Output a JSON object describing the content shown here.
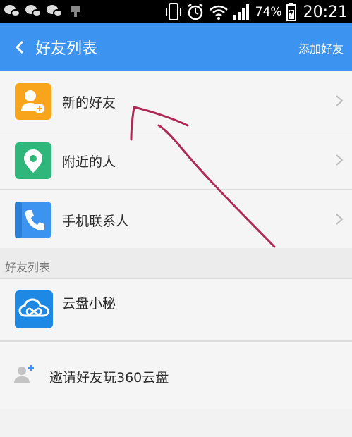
{
  "status_bar": {
    "battery_percent": "74%",
    "time": "20:21",
    "icons": [
      "wechat-icon",
      "wechat-icon",
      "wechat-icon",
      "usb-icon",
      "phone-vibrate-icon",
      "alarm-icon",
      "wifi-icon",
      "signal-icon",
      "battery-charging-icon"
    ]
  },
  "header": {
    "title": "好友列表",
    "add_label": "添加好友"
  },
  "rows": [
    {
      "label": "新的好友",
      "icon": "new-friend-icon",
      "color": "#f9a51b"
    },
    {
      "label": "附近的人",
      "icon": "location-pin-icon",
      "color": "#2fb67a"
    },
    {
      "label": "手机联系人",
      "icon": "phone-icon",
      "color": "#3d93f0"
    }
  ],
  "section": {
    "title": "好友列表"
  },
  "friend": {
    "label": "云盘小秘",
    "icon": "cloud-icon",
    "color": "#1e88e5"
  },
  "invite": {
    "label": "邀请好友玩360云盘",
    "icon": "add-person-icon"
  },
  "annotation": {
    "color": "#b02a57"
  }
}
